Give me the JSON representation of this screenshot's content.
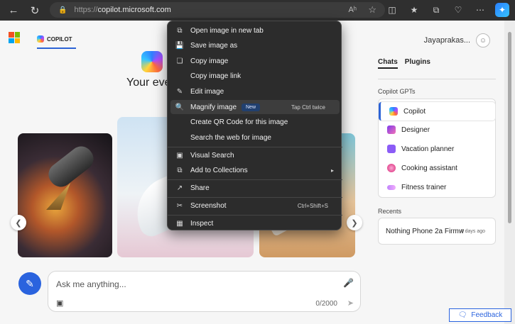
{
  "browser": {
    "url_prefix": "https://",
    "url_host": "copilot.microsoft.com",
    "read_aloud_glyph": "Aʰ"
  },
  "header": {
    "tab_label": "COPILOT",
    "username": "Jayaprakas..."
  },
  "hero": {
    "title_partial": "Your every"
  },
  "composer": {
    "placeholder": "Ask me anything...",
    "char_count": "0/2000"
  },
  "right_panel": {
    "tabs": [
      "Chats",
      "Plugins"
    ],
    "gpts_label": "Copilot GPTs",
    "gpts": [
      {
        "label": "Copilot",
        "color": "#3b82f6"
      },
      {
        "label": "Designer",
        "color": "#a855f7"
      },
      {
        "label": "Vacation planner",
        "color": "#8b5cf6"
      },
      {
        "label": "Cooking assistant",
        "color": "#ec4899"
      },
      {
        "label": "Fitness trainer",
        "color": "#c084fc"
      }
    ],
    "recents_label": "Recents",
    "recents": [
      {
        "title": "Nothing Phone 2a Firmw",
        "date": "4 days ago"
      }
    ],
    "feedback_label": "Feedback"
  },
  "context_menu": {
    "items": [
      {
        "label": "Open image in new tab",
        "icon": "open-tab-icon"
      },
      {
        "label": "Save image as",
        "icon": "save-icon"
      },
      {
        "label": "Copy image",
        "icon": "copy-icon"
      },
      {
        "label": "Copy image link",
        "icon": ""
      },
      {
        "label": "Edit image",
        "icon": "edit-icon"
      },
      {
        "label": "Magnify image",
        "icon": "magnify-icon",
        "badge": "New",
        "shortcut": "Tap Ctrl twice"
      },
      {
        "label": "Create QR Code for this image",
        "icon": ""
      },
      {
        "label": "Search the web for image",
        "icon": ""
      },
      {
        "label": "Visual Search",
        "icon": "visual-search-icon"
      },
      {
        "label": "Add to Collections",
        "icon": "collections-icon",
        "submenu": true
      },
      {
        "label": "Share",
        "icon": "share-icon"
      },
      {
        "label": "Screenshot",
        "icon": "screenshot-icon",
        "shortcut": "Ctrl+Shift+S"
      },
      {
        "label": "Inspect",
        "icon": "inspect-icon"
      }
    ]
  },
  "colors": {
    "accent": "#2a63de",
    "menu_bg": "#2c2c2c",
    "page_bg": "#f6f6f6"
  }
}
